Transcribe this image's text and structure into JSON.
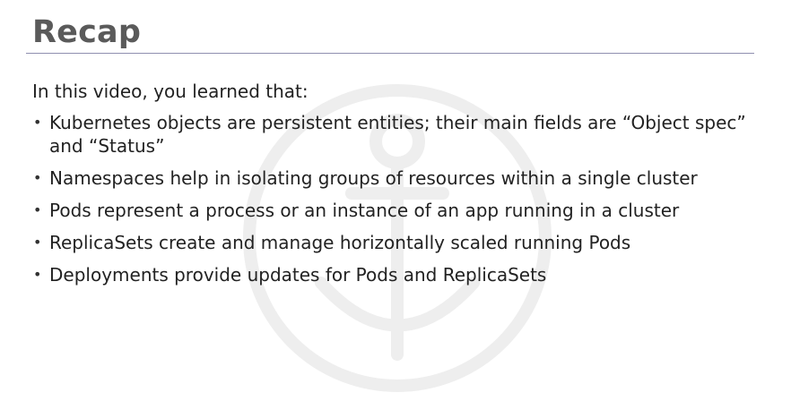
{
  "slide": {
    "title": "Recap",
    "intro": "In this video, you learned that:",
    "bullets": [
      "Kubernetes objects are persistent entities; their main fields are “Object spec” and “Status”",
      "Namespaces help in isolating groups of resources within a single cluster",
      "Pods represent a process or an instance of an app running in a cluster",
      "ReplicaSets create and manage horizontally scaled running Pods",
      "Deployments provide updates for Pods and ReplicaSets"
    ],
    "bullet_glyph": "•"
  },
  "colors": {
    "title": "#5a5a5a",
    "rule": "#8f8fb0",
    "text": "#222222",
    "watermark": "#eeeeee"
  },
  "icons": {
    "watermark": "anchor-icon"
  }
}
